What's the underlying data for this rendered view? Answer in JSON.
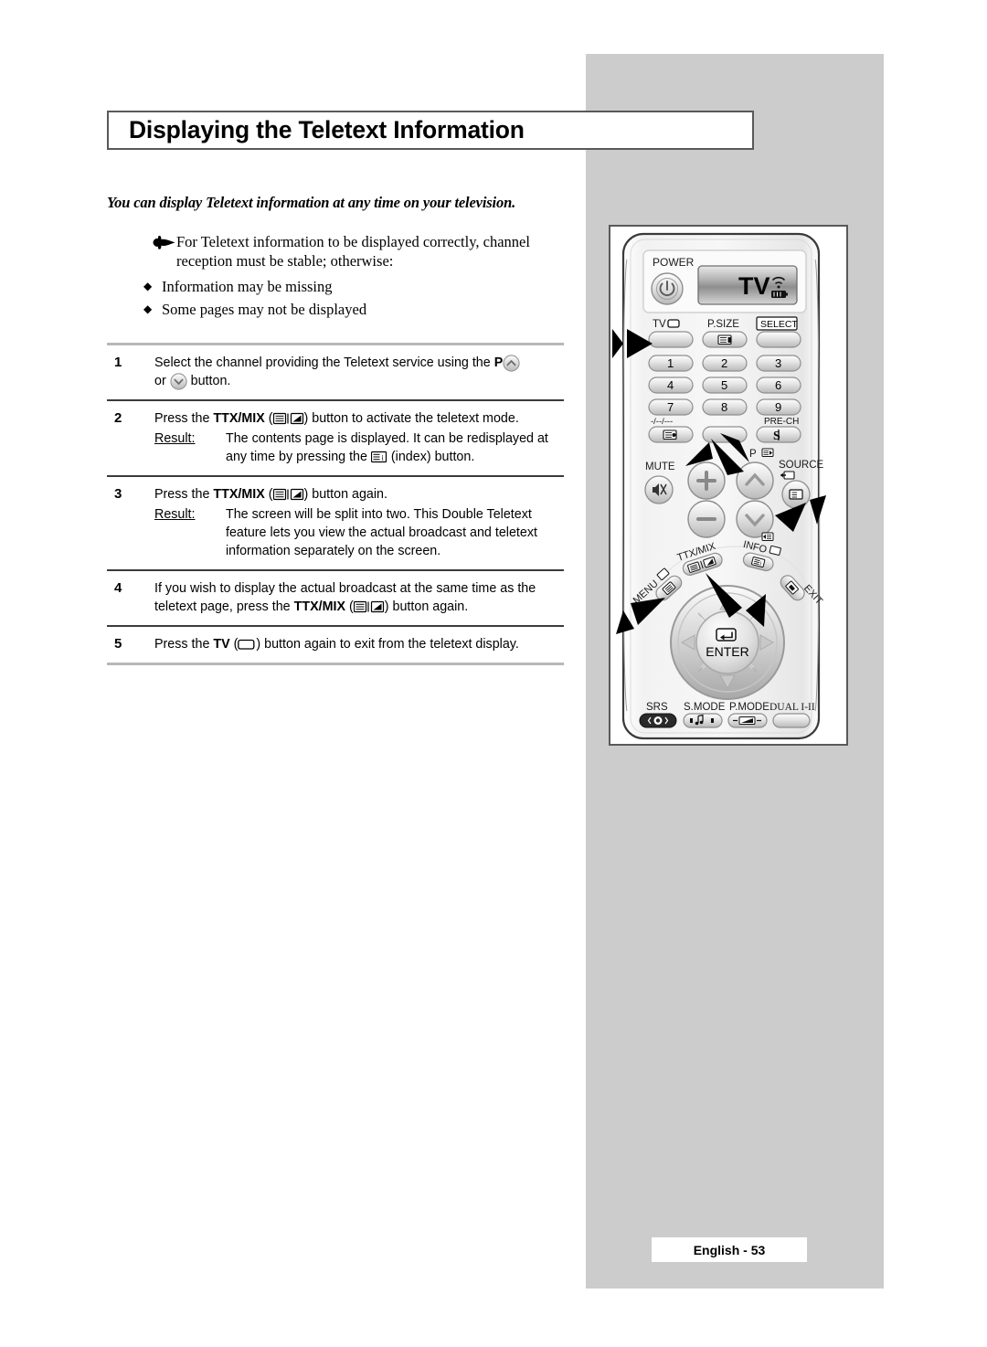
{
  "page": {
    "title": "Displaying the Teletext Information",
    "intro": "You can display Teletext information at any time on your television.",
    "footer": "English - 53"
  },
  "note": {
    "icon": "pointing-hand-icon",
    "text": "For Teletext information to be displayed correctly, channel reception must be stable; otherwise:",
    "bullets": [
      "Information may be missing",
      "Some pages may not be displayed"
    ]
  },
  "steps": [
    {
      "number": "1",
      "text_parts": [
        {
          "t": "Select the channel providing the Teletext service using the "
        },
        {
          "t": "P",
          "bold": true
        },
        {
          "icon": "page-up-icon"
        },
        {
          "t": " or "
        },
        {
          "icon": "page-down-icon"
        },
        {
          "t": " button."
        }
      ],
      "plain": "Select the channel providing the Teletext service using the P or button.",
      "result": null
    },
    {
      "number": "2",
      "plain": "Press the TTX/MIX ( ) button to activate the teletext mode.",
      "result": {
        "label": "Result:",
        "text": "The contents page is displayed. It can be redisplayed at any time by pressing the (index) button."
      }
    },
    {
      "number": "3",
      "plain": "Press the TTX/MIX ( ) button again.",
      "result": {
        "label": "Result:",
        "text": "The screen will be split into two. This Double Teletext feature lets you view the actual broadcast and teletext information separately on the screen."
      }
    },
    {
      "number": "4",
      "plain": "If you wish to display the actual broadcast at the same time as the teletext page, press the TTX/MIX ( ) button again.",
      "result": null
    },
    {
      "number": "5",
      "plain": "Press the TV ( ) button again to exit from the teletext display.",
      "result": null
    }
  ],
  "remote": {
    "labels": {
      "power": "POWER",
      "display": "TV",
      "tv": "TV",
      "psize": "P.SIZE",
      "select": "SELECT",
      "prech": "PRE-CH",
      "dash": "-/--/---",
      "mute": "MUTE",
      "p": "P",
      "source": "SOURCE",
      "menu": "MENU",
      "ttxmix": "TTX/MIX",
      "info": "INFO",
      "exit": "EXIT",
      "enter": "ENTER",
      "srs": "SRS",
      "smode": "S.MODE",
      "pmode": "P.MODE",
      "dual": "DUAL I-II"
    },
    "keypad": [
      "1",
      "2",
      "3",
      "4",
      "5",
      "6",
      "7",
      "8",
      "9"
    ],
    "callouts": [
      "tv-button-arrow",
      "zero-button-arrow",
      "channel-up-arrow",
      "channel-down-arrow",
      "ttx-mix-arrow",
      "menu-arrow"
    ]
  },
  "colors": {
    "panel_gray": "#cccccc",
    "border_dark": "#58595b",
    "rule_dark": "#3b3b3b",
    "rule_light": "#b6b8ba",
    "text": "#000000"
  }
}
